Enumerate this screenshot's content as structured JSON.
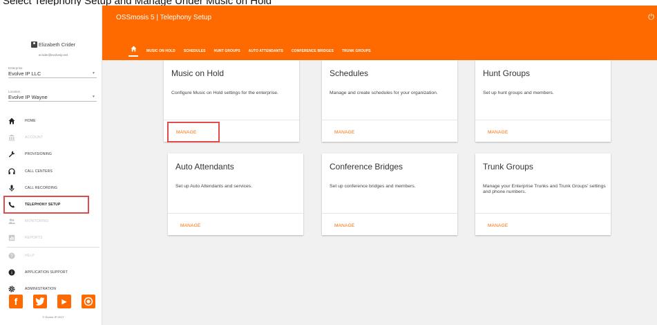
{
  "caption": "Select Telephony Setup and Manage Under Music on Hold",
  "header": {
    "title": "OSSmosis 5 | Telephony Setup",
    "tabs": [
      "MUSIC ON HOLD",
      "SCHEDULES",
      "HUNT GROUPS",
      "AUTO ATTENDANTS",
      "CONFERENCE BRIDGES",
      "TRUNK GROUPS"
    ]
  },
  "user": {
    "name": "Elizabeth Crider",
    "email": "ecrider@evolveip.net"
  },
  "enterprise": {
    "label": "Enterprise",
    "value": "Evolve IP LLC"
  },
  "location": {
    "label": "Location",
    "value": "Evolve IP Wayne"
  },
  "nav": [
    {
      "label": "HOME",
      "icon": "home-icon"
    },
    {
      "label": "ACCOUNT",
      "icon": "bank-icon"
    },
    {
      "label": "PROVISIONING",
      "icon": "wrench-icon"
    },
    {
      "label": "CALL CENTERS",
      "icon": "headset-icon"
    },
    {
      "label": "CALL RECORDING",
      "icon": "microphone-icon"
    },
    {
      "label": "TELEPHONY SETUP",
      "icon": "phone-icon"
    },
    {
      "label": "MONITORING",
      "icon": "users-icon"
    },
    {
      "label": "REPORTS",
      "icon": "report-icon"
    },
    {
      "label": "HELP",
      "icon": "help-icon"
    },
    {
      "label": "APPLICATION SUPPORT",
      "icon": "info-icon"
    },
    {
      "label": "ADMINISTRATION",
      "icon": "gear-icon"
    }
  ],
  "copyright": "© Evolve IP 2017",
  "cards": [
    {
      "title": "Music on Hold",
      "desc": "Configure Music on Hold settings for the enterprise.",
      "button": "MANAGE"
    },
    {
      "title": "Schedules",
      "desc": "Manage and create schedules for your organization.",
      "button": "MANAGE"
    },
    {
      "title": "Hunt Groups",
      "desc": "Set up hunt groups and members.",
      "button": "MANAGE"
    },
    {
      "title": "Auto Attendants",
      "desc": "Set up Auto Attendants and services.",
      "button": "MANAGE"
    },
    {
      "title": "Conference Bridges",
      "desc": "Set up conference bridges and members.",
      "button": "MANAGE"
    },
    {
      "title": "Trunk Groups",
      "desc": "Manage your Enterprise Trunks and Trunk Groups' settings and phone numbers.",
      "button": "MANAGE"
    }
  ],
  "colors": {
    "brand": "#ff6a00",
    "highlight": "#e04a4a"
  }
}
